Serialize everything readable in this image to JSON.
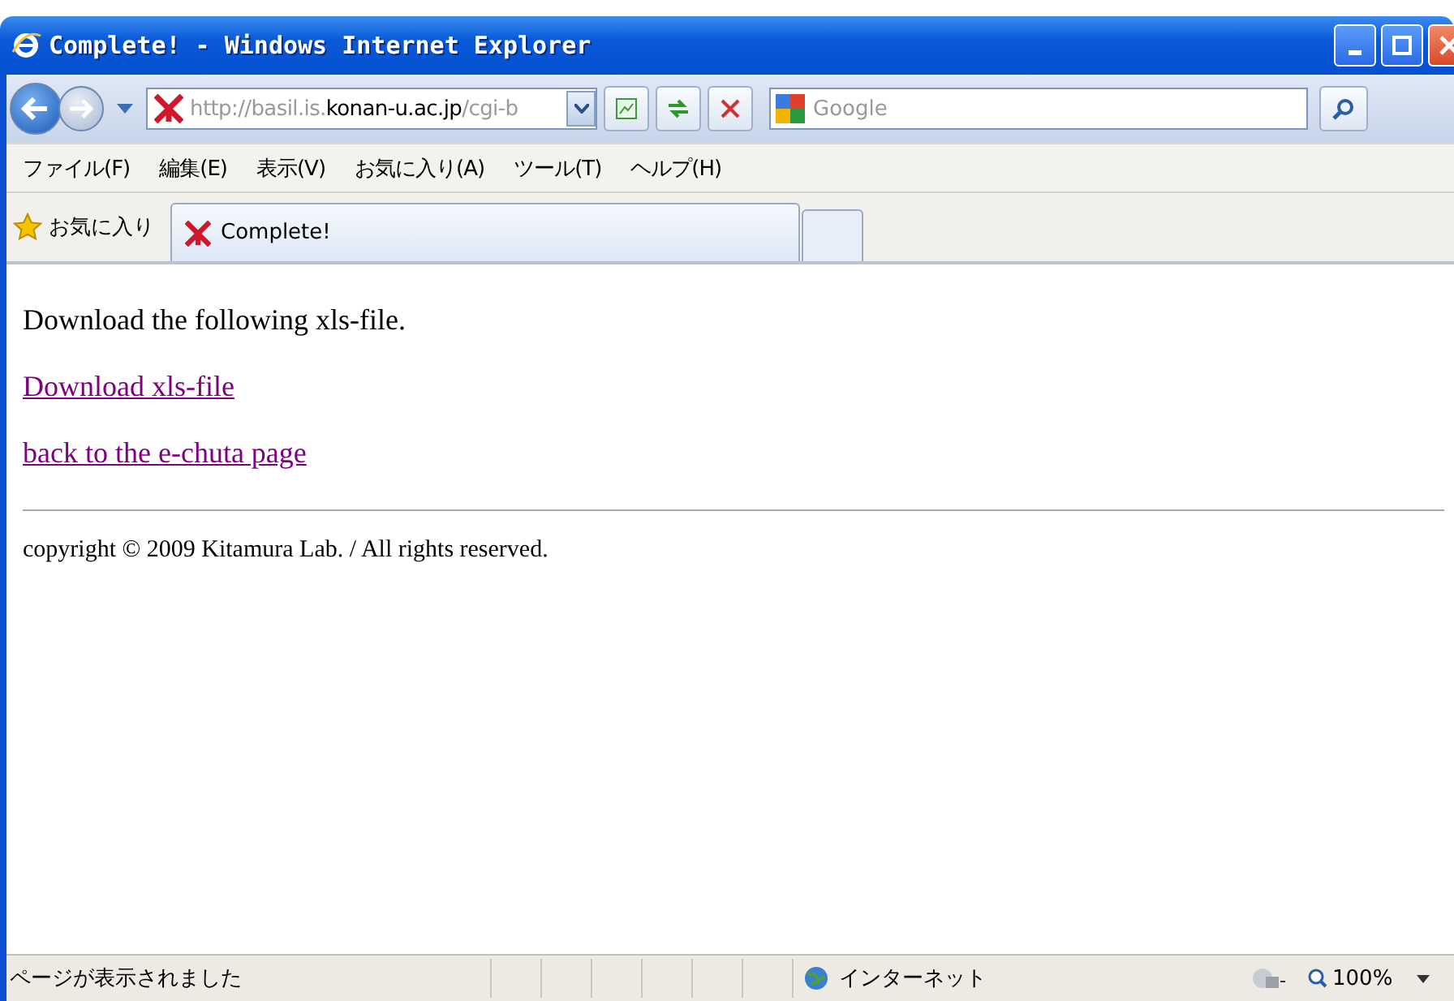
{
  "window": {
    "title": "Complete! - Windows Internet Explorer"
  },
  "address": {
    "prefix": "http://basil.is.",
    "host": "konan-u.ac.jp",
    "suffix": "/cgi-b"
  },
  "search": {
    "placeholder": "Google"
  },
  "menu": [
    "ファイル(F)",
    "編集(E)",
    "表示(V)",
    "お気に入り(A)",
    "ツール(T)",
    "ヘルプ(H)"
  ],
  "favorites": {
    "label": "お気に入り"
  },
  "tabs": [
    {
      "label": "Complete!",
      "selected": true
    }
  ],
  "page": {
    "intro": "Download the following xls-file.",
    "links": [
      "Download xls-file",
      "back to the e-chuta page"
    ],
    "copyright": "copyright © 2009 Kitamura Lab. / All rights reserved."
  },
  "status_bar": {
    "message": "ページが表示されました",
    "zone": "インターネット",
    "zoom": "100%"
  }
}
